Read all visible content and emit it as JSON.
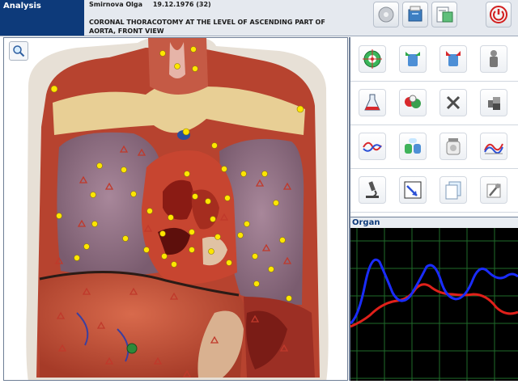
{
  "header": {
    "section_label": "Analysis",
    "patient_name": "Smirnova  Olga",
    "patient_dob": "19.12.1976 (32)",
    "view_title": "CORONAL THORACOTOMY AT THE LEVEL OF ASCENDING PART OF AORTA, FRONT VIEW",
    "buttons": [
      "disc-icon",
      "database-icon",
      "report-icon",
      "power-icon"
    ]
  },
  "image_panel": {
    "zoom_icon": "magnifier-icon",
    "marker_colors": {
      "point": "#ffe600",
      "triangle": "#c0392b"
    }
  },
  "tools": {
    "row1": [
      "target-icon",
      "organ-green-icon",
      "organ-blue-red-icon",
      "grey-figure-icon"
    ],
    "row2": [
      "flask-icon",
      "cells-icon",
      "close-x-icon",
      "cubes-icon"
    ],
    "row3": [
      "wave-icon",
      "capsules-icon",
      "jar-icon",
      "spectrum-icon"
    ],
    "row4": [
      "microscope-icon",
      "chart-arrow-icon",
      "pages-icon",
      "tools-icon"
    ]
  },
  "organ_panel": {
    "title": "Organ",
    "grid_color": "#1f6b2a",
    "series_colors": {
      "blue": "#1a2cff",
      "red": "#e0201a"
    }
  }
}
